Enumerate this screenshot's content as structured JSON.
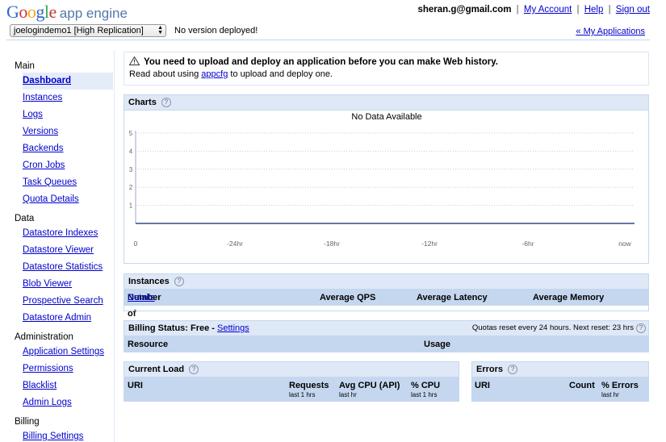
{
  "header": {
    "logo_google": "Google",
    "logo_product": "app engine",
    "email": "sheran.g@gmail.com",
    "sep": "|",
    "my_account": "My Account",
    "help": "Help",
    "sign_out": "Sign out"
  },
  "appbar": {
    "selected_app": "joelogindemo1 [High Replication]",
    "status": "No version deployed!",
    "my_applications": "« My Applications"
  },
  "sidebar": {
    "sections": [
      {
        "title": "Main",
        "items": [
          "Dashboard",
          "Instances",
          "Logs",
          "Versions",
          "Backends",
          "Cron Jobs",
          "Task Queues",
          "Quota Details"
        ]
      },
      {
        "title": "Data",
        "items": [
          "Datastore Indexes",
          "Datastore Viewer",
          "Datastore Statistics",
          "Blob Viewer",
          "Prospective Search",
          "Datastore Admin"
        ]
      },
      {
        "title": "Administration",
        "items": [
          "Application Settings",
          "Permissions",
          "Blacklist",
          "Admin Logs"
        ]
      },
      {
        "title": "Billing",
        "items": [
          "Billing Settings"
        ]
      }
    ],
    "active_item": "Dashboard"
  },
  "alert": {
    "title": "You need to upload and deploy an application before you can make Web history.",
    "msg_before": "Read about using ",
    "msg_link": "appcfg",
    "msg_after": " to upload and deploy one."
  },
  "charts": {
    "title": "Charts",
    "help": "?"
  },
  "chart_data": {
    "type": "line",
    "title": "No Data Available",
    "x_tick_labels": [
      "0",
      "-24hr",
      "-18hr",
      "-12hr",
      "-6hr",
      "now"
    ],
    "y_tick_labels": [
      "1",
      "2",
      "3",
      "4",
      "5"
    ],
    "ylim": [
      0,
      5
    ],
    "grid": true,
    "series": []
  },
  "instances": {
    "title": "Instances",
    "help": "?",
    "col_count_label": "Number of Instances - ",
    "col_count_link": "Details",
    "col_qps": "Average QPS",
    "col_latency": "Average Latency",
    "col_memory": "Average Memory"
  },
  "billing": {
    "status_label": "Billing Status: Free - ",
    "settings_link": "Settings",
    "quota_text": "Quotas reset every 24 hours. Next reset: 23 hrs",
    "help": "?",
    "col_resource": "Resource",
    "col_usage": "Usage"
  },
  "current_load": {
    "title": "Current Load",
    "help": "?",
    "col_uri": "URI",
    "col_requests": "Requests",
    "col_requests_sub": "last 1 hrs",
    "col_avg_cpu": "Avg CPU (API)",
    "col_avg_cpu_sub": "last hr",
    "col_pct_cpu": "% CPU",
    "col_pct_cpu_sub": "last 1 hrs"
  },
  "errors": {
    "title": "Errors",
    "help": "?",
    "col_uri": "URI",
    "col_count": "Count",
    "col_pct_errors": "% Errors",
    "col_pct_errors_sub": "last hr"
  }
}
